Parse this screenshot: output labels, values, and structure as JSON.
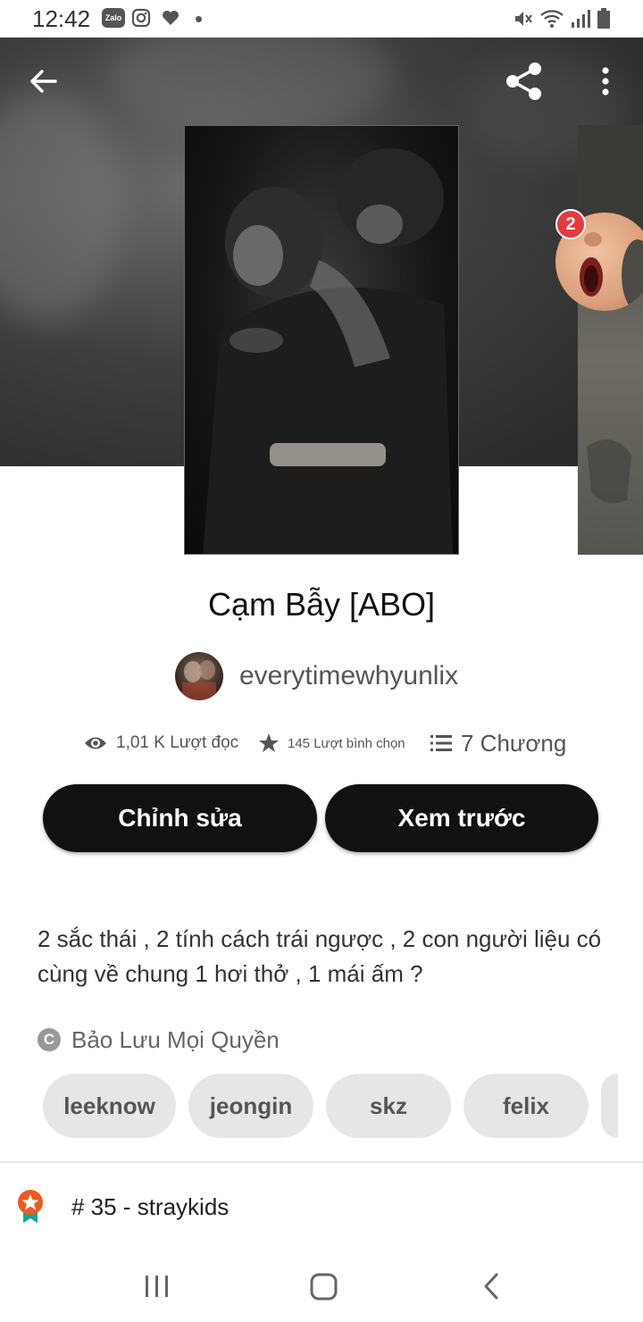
{
  "status_bar": {
    "time": "12:42",
    "notification_icons": [
      "zalo-icon",
      "instagram-icon",
      "heart-icon",
      "dot-icon"
    ],
    "system_icons": [
      "mute-icon",
      "wifi-icon",
      "signal-icon",
      "battery-icon"
    ],
    "zalo_label": "Zalo"
  },
  "header": {
    "back_icon": "arrow-left-icon",
    "share_icon": "share-icon",
    "more_icon": "more-vertical-icon"
  },
  "chat_bubble": {
    "badge_count": "2"
  },
  "story": {
    "title": "Cạm Bẫy [ABO]",
    "author": "everytimewhyunlix",
    "stats": {
      "reads": "1,01 K Lượt đọc",
      "votes": "145 Lượt bình chọn",
      "chapters": "7 Chương"
    },
    "buttons": {
      "edit": "Chỉnh sửa",
      "preview": "Xem trước"
    },
    "description": "2 sắc thái , 2 tính cách trái ngược , 2 con người liệu có cùng về chung 1 hơi thở , 1 mái ấm ?",
    "copyright": "Bảo Lưu Mọi Quyền",
    "tags": [
      "leeknow",
      "jeongin",
      "skz",
      "felix"
    ],
    "ranking": "# 35 - straykids"
  },
  "colors": {
    "button_bg": "#111111",
    "tag_bg": "#e6e6e6",
    "badge": "#e8393a",
    "rank_badge": "#f05a22",
    "rank_ribbon": "#16a596"
  }
}
